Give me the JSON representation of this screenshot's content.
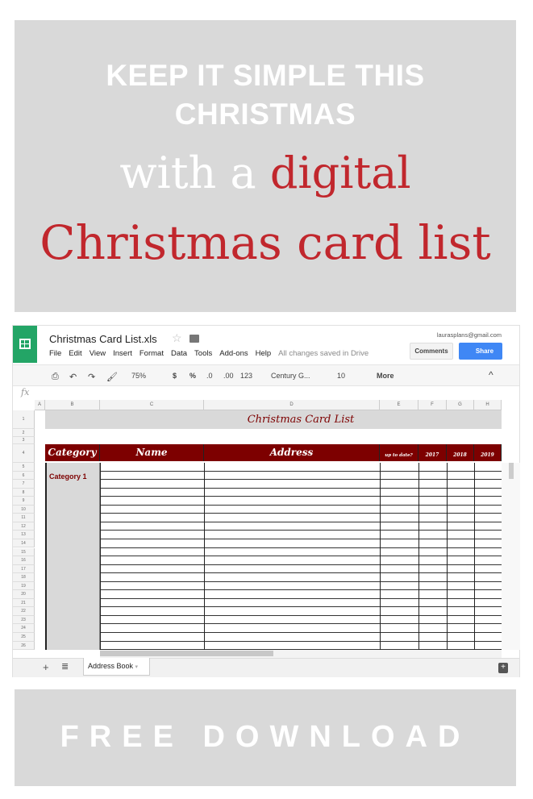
{
  "banner_top": {
    "line1": "KEEP IT SIMPLE THIS",
    "line2": "CHRISTMAS",
    "line3_white": "with a ",
    "line3_red": "digital",
    "line4": "Christmas card list"
  },
  "app": {
    "doc_title": "Christmas Card List.xls",
    "account": "laurasplans@gmail.com",
    "menu": [
      "File",
      "Edit",
      "View",
      "Insert",
      "Format",
      "Data",
      "Tools",
      "Add-ons",
      "Help"
    ],
    "save_status": "All changes saved in Drive",
    "comments": "Comments",
    "share": "Share"
  },
  "toolbar": {
    "zoom": "75%",
    "currency": "$",
    "percent": "%",
    "dec_less": ".0",
    "dec_more": ".00",
    "format": "123",
    "font": "Century G...",
    "size": "10",
    "more": "More"
  },
  "formula_bar": {
    "fx": "fx",
    "value": ""
  },
  "columns": [
    "A",
    "B",
    "C",
    "D",
    "E",
    "F",
    "G",
    "H"
  ],
  "sheet": {
    "title": "Christmas Card List",
    "headers": {
      "category": "Category",
      "name": "Name",
      "address": "Address",
      "up_to_date": "up to date?",
      "y1": "2017",
      "y2": "2018",
      "y3": "2019"
    },
    "category_1": "Category 1",
    "rows": [
      "1",
      "2",
      "3",
      "4",
      "5",
      "6",
      "7",
      "8",
      "9",
      "10",
      "11",
      "12",
      "13",
      "14",
      "15",
      "16",
      "17",
      "18",
      "19",
      "20",
      "21",
      "22",
      "23",
      "24",
      "25",
      "26"
    ],
    "header_color": "#7d0000"
  },
  "tabs": {
    "active": "Address Book"
  },
  "banner_bottom": {
    "text": "FREE DOWNLOAD"
  }
}
